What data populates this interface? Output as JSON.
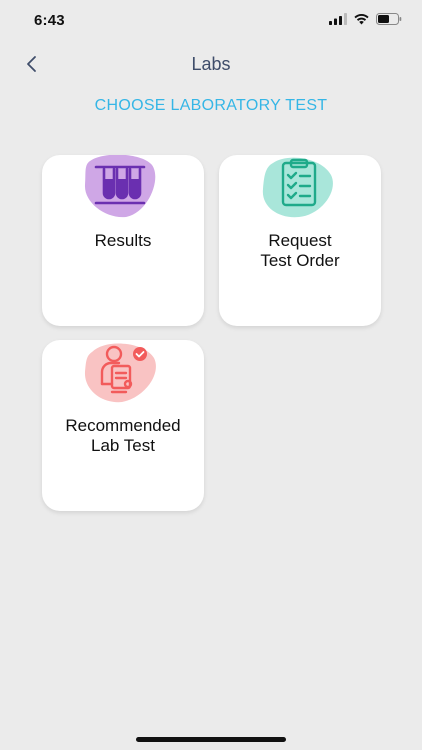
{
  "status": {
    "time": "6:43"
  },
  "header": {
    "title": "Labs"
  },
  "subtitle": "CHOOSE LABORATORY TEST",
  "cards": [
    {
      "label": "Results",
      "icon": "test-tubes-icon",
      "blob_color": "#cfa7e6",
      "icon_color": "#6a2fb0"
    },
    {
      "label": "Request\nTest Order",
      "icon": "clipboard-checklist-icon",
      "blob_color": "#a9e6da",
      "icon_color": "#1faa8a"
    },
    {
      "label": "Recommended\nLab Test",
      "icon": "doctor-recommendation-icon",
      "blob_color": "#f9c3c3",
      "icon_color": "#f25b5b"
    }
  ]
}
